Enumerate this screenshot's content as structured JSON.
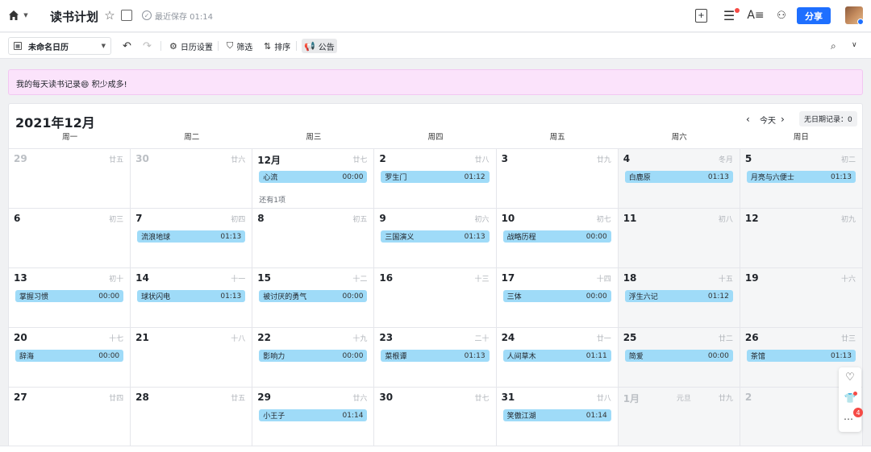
{
  "header": {
    "doc_title": "读书计划",
    "saved_text": "最近保存 01:14",
    "share_label": "分享"
  },
  "toolbar": {
    "calendar_name": "未命名日历",
    "calendar_settings": "日历设置",
    "filter": "筛选",
    "sort": "排序",
    "announcement": "公告"
  },
  "announcement_text": "我的每天读书记录😄 积少成多!",
  "calendar": {
    "title": "2021年12月",
    "today_label": "今天",
    "no_date_records": "无日期记录：0",
    "weekdays": [
      "周一",
      "周二",
      "周三",
      "周四",
      "周五",
      "周六",
      "周日"
    ],
    "days": [
      {
        "day": "29",
        "lunar": "廿五",
        "muted": true,
        "weekend": false
      },
      {
        "day": "30",
        "lunar": "廿六",
        "muted": true,
        "weekend": false
      },
      {
        "day": "12月",
        "lunar": "廿七",
        "muted": false,
        "weekend": false,
        "event": {
          "title": "心流",
          "time": "00:00"
        },
        "more": "还有1项"
      },
      {
        "day": "2",
        "lunar": "廿八",
        "muted": false,
        "weekend": false,
        "event": {
          "title": "罗生门",
          "time": "01:12"
        }
      },
      {
        "day": "3",
        "lunar": "廿九",
        "muted": false,
        "weekend": false
      },
      {
        "day": "4",
        "lunar": "冬月",
        "muted": false,
        "weekend": true,
        "event": {
          "title": "白鹿原",
          "time": "01:13"
        }
      },
      {
        "day": "5",
        "lunar": "初二",
        "muted": false,
        "weekend": true,
        "event": {
          "title": "月亮与六便士",
          "time": "01:13"
        }
      },
      {
        "day": "6",
        "lunar": "初三",
        "muted": false,
        "weekend": false
      },
      {
        "day": "7",
        "lunar": "初四",
        "muted": false,
        "weekend": false,
        "event": {
          "title": "流浪地球",
          "time": "01:13"
        }
      },
      {
        "day": "8",
        "lunar": "初五",
        "muted": false,
        "weekend": false
      },
      {
        "day": "9",
        "lunar": "初六",
        "muted": false,
        "weekend": false,
        "event": {
          "title": "三国演义",
          "time": "01:13"
        }
      },
      {
        "day": "10",
        "lunar": "初七",
        "muted": false,
        "weekend": false,
        "event": {
          "title": "战略历程",
          "time": "00:00"
        }
      },
      {
        "day": "11",
        "lunar": "初八",
        "muted": false,
        "weekend": true
      },
      {
        "day": "12",
        "lunar": "初九",
        "muted": false,
        "weekend": true
      },
      {
        "day": "13",
        "lunar": "初十",
        "muted": false,
        "weekend": false,
        "event": {
          "title": "掌握习惯",
          "time": "00:00"
        }
      },
      {
        "day": "14",
        "lunar": "十一",
        "muted": false,
        "weekend": false,
        "event": {
          "title": "球状闪电",
          "time": "01:13"
        }
      },
      {
        "day": "15",
        "lunar": "十二",
        "muted": false,
        "weekend": false,
        "event": {
          "title": "被讨厌的勇气",
          "time": "00:00"
        }
      },
      {
        "day": "16",
        "lunar": "十三",
        "muted": false,
        "weekend": false
      },
      {
        "day": "17",
        "lunar": "十四",
        "muted": false,
        "weekend": false,
        "event": {
          "title": "三体",
          "time": "00:00"
        }
      },
      {
        "day": "18",
        "lunar": "十五",
        "muted": false,
        "weekend": true,
        "event": {
          "title": "浮生六记",
          "time": "01:12"
        }
      },
      {
        "day": "19",
        "lunar": "十六",
        "muted": false,
        "weekend": true
      },
      {
        "day": "20",
        "lunar": "十七",
        "muted": false,
        "weekend": false,
        "event": {
          "title": "辞海",
          "time": "00:00"
        }
      },
      {
        "day": "21",
        "lunar": "十八",
        "muted": false,
        "weekend": false
      },
      {
        "day": "22",
        "lunar": "十九",
        "muted": false,
        "weekend": false,
        "event": {
          "title": "影响力",
          "time": "00:00"
        }
      },
      {
        "day": "23",
        "lunar": "二十",
        "muted": false,
        "weekend": false,
        "event": {
          "title": "菜根谭",
          "time": "01:13"
        }
      },
      {
        "day": "24",
        "lunar": "廿一",
        "muted": false,
        "weekend": false,
        "event": {
          "title": "人间草木",
          "time": "01:11"
        }
      },
      {
        "day": "25",
        "lunar": "廿二",
        "muted": false,
        "weekend": true,
        "event": {
          "title": "简爱",
          "time": "00:00"
        }
      },
      {
        "day": "26",
        "lunar": "廿三",
        "muted": false,
        "weekend": true,
        "event": {
          "title": "茶馆",
          "time": "01:13"
        }
      },
      {
        "day": "27",
        "lunar": "廿四",
        "muted": false,
        "weekend": false
      },
      {
        "day": "28",
        "lunar": "廿五",
        "muted": false,
        "weekend": false
      },
      {
        "day": "29",
        "lunar": "廿六",
        "muted": false,
        "weekend": false,
        "event": {
          "title": "小王子",
          "time": "01:14"
        }
      },
      {
        "day": "30",
        "lunar": "廿七",
        "muted": false,
        "weekend": false
      },
      {
        "day": "31",
        "lunar": "廿八",
        "muted": false,
        "weekend": false,
        "event": {
          "title": "笑傲江湖",
          "time": "01:14"
        }
      },
      {
        "day": "1月",
        "lunar": "廿九",
        "lunar2": "元旦",
        "muted": true,
        "weekend": true
      },
      {
        "day": "2",
        "lunar": "",
        "muted": true,
        "weekend": true
      }
    ]
  },
  "side_panel": {
    "badge_count": "4"
  }
}
